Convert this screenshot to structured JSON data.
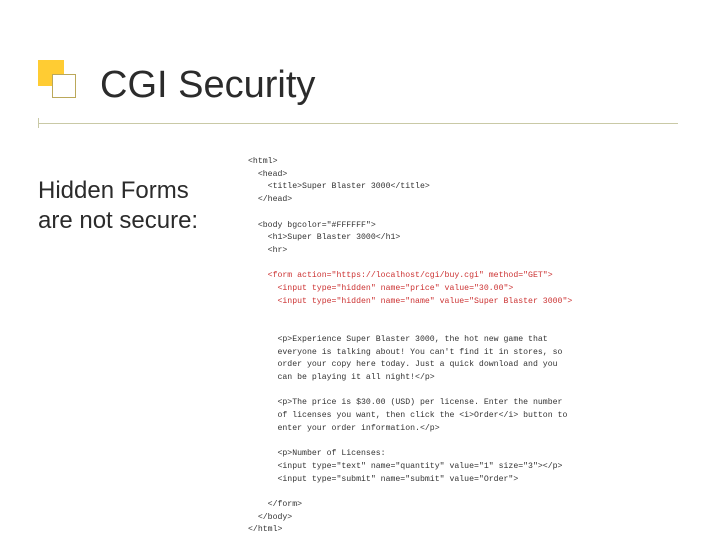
{
  "title": "CGI Security",
  "subtitle": "Hidden Forms are not secure:",
  "code": {
    "l01": "<html>",
    "l02": "  <head>",
    "l03": "    <title>Super Blaster 3000</title>",
    "l04": "  </head>",
    "l05": "",
    "l06": "  <body bgcolor=\"#FFFFFF\">",
    "l07": "    <h1>Super Blaster 3000</h1>",
    "l08": "    <hr>",
    "l09": "",
    "l10": "    <form action=\"https://localhost/cgi/buy.cgi\" method=\"GET\">",
    "l11": "      <input type=\"hidden\" name=\"price\" value=\"30.00\">",
    "l12": "      <input type=\"hidden\" name=\"name\" value=\"Super Blaster 3000\">",
    "l13": "",
    "l14": "",
    "l15": "      <p>Experience Super Blaster 3000, the hot new game that",
    "l16": "      everyone is talking about! You can't find it in stores, so",
    "l17": "      order your copy here today. Just a quick download and you",
    "l18": "      can be playing it all night!</p>",
    "l19": "",
    "l20": "      <p>The price is $30.00 (USD) per license. Enter the number",
    "l21": "      of licenses you want, then click the <i>Order</i> button to",
    "l22": "      enter your order information.</p>",
    "l23": "",
    "l24": "      <p>Number of Licenses:",
    "l25": "      <input type=\"text\" name=\"quantity\" value=\"1\" size=\"3\"></p>",
    "l26": "      <input type=\"submit\" name=\"submit\" value=\"Order\">",
    "l27": "",
    "l28": "    </form>",
    "l29": "  </body>",
    "l30": "</html>"
  }
}
